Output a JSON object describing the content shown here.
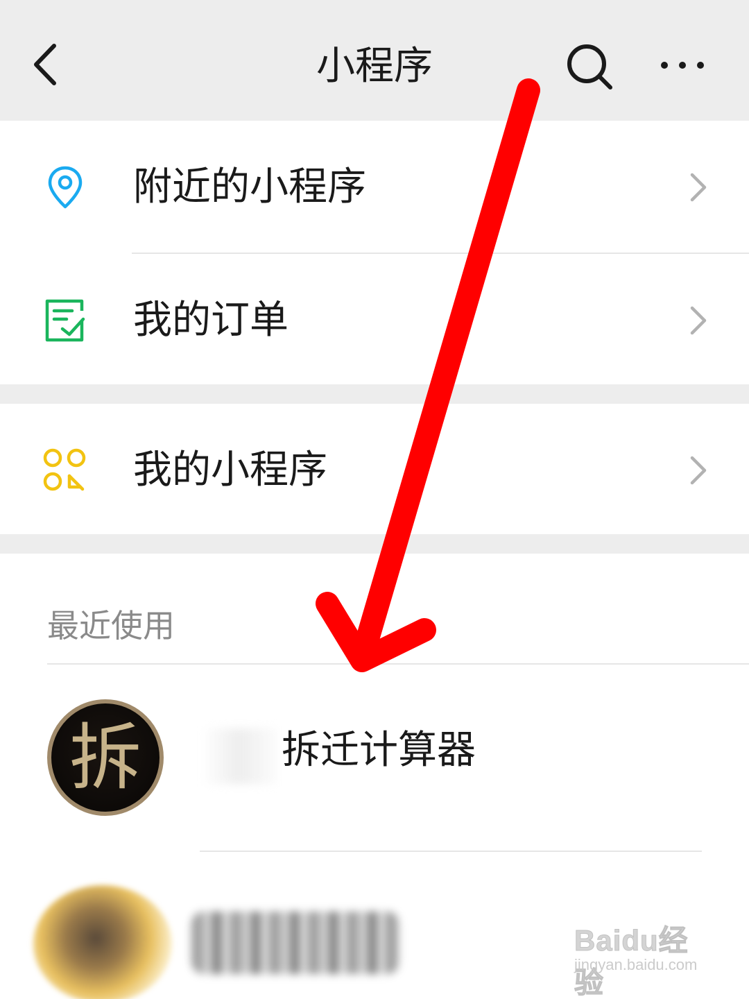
{
  "header": {
    "title": "小程序"
  },
  "menu": {
    "nearby": {
      "label": "附近的小程序",
      "icon": "location-pin-icon"
    },
    "orders": {
      "label": "我的订单",
      "icon": "order-list-icon"
    },
    "my_apps": {
      "label": "我的小程序",
      "icon": "mini-program-grid-icon"
    }
  },
  "recent": {
    "title": "最近使用",
    "items": [
      {
        "name": "拆迁计算器",
        "avatar_char": "拆"
      }
    ]
  },
  "watermark": {
    "logo": "Baidu经验",
    "url": "jingyan.baidu.com"
  },
  "colors": {
    "location_icon": "#1aaaf0",
    "order_icon": "#1ab55c",
    "grid_icon": "#f2c311",
    "arrow": "#ff0000",
    "chevron": "#b2b2b2"
  }
}
